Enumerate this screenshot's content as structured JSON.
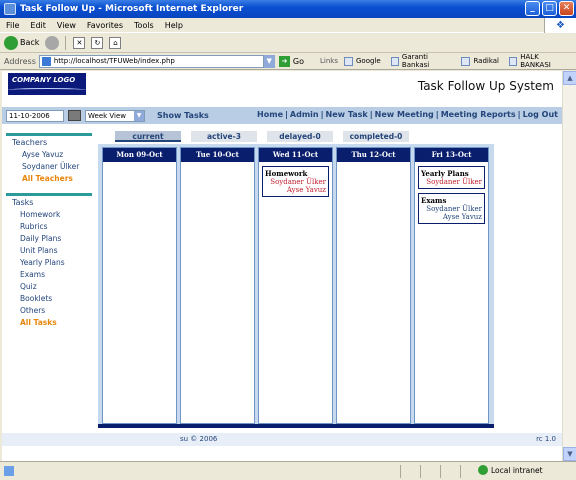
{
  "window": {
    "title": "Task Follow Up - Microsoft Internet Explorer",
    "controls": {
      "minimize": "_",
      "maximize": "□",
      "close": "✕"
    }
  },
  "menu": [
    "File",
    "Edit",
    "View",
    "Favorites",
    "Tools",
    "Help"
  ],
  "toolbar": {
    "back": "Back",
    "go": "Go"
  },
  "address": {
    "label": "Address",
    "url": "http://localhost/TFUWeb/index.php"
  },
  "links": {
    "title": "Links",
    "items": [
      "Google",
      "Garanti Bankasi",
      "Radikal",
      "HALK BANKASI"
    ]
  },
  "page": {
    "logo": "COMPANY LOGO",
    "system_title": "Task Follow Up System",
    "date_value": "11-10-2006",
    "view_value": "Week View",
    "show_tasks": "Show Tasks",
    "nav": [
      "Home",
      "Admin",
      "New Task",
      "New Meeting",
      "Meeting Reports",
      "Log Out"
    ],
    "nav_sep": "|",
    "sidebar": {
      "teachers_title": "Teachers",
      "teachers": [
        "Ayse Yavuz",
        "Soydaner Ülker"
      ],
      "all_teachers": "All Teachers",
      "tasks_title": "Tasks",
      "tasks": [
        "Homework",
        "Rubrics",
        "Daily Plans",
        "Unit Plans",
        "Yearly Plans",
        "Exams",
        "Quiz",
        "Booklets",
        "Others"
      ],
      "all_tasks": "All Tasks"
    },
    "tabs": [
      "current",
      "active-3",
      "delayed-0",
      "completed-0"
    ],
    "days": [
      {
        "label": "Mon 09-Oct",
        "cards": []
      },
      {
        "label": "Tue 10-Oct",
        "cards": []
      },
      {
        "label": "Wed 11-Oct",
        "cards": [
          {
            "title": "Homework",
            "names": [
              "Soydaner Ülker",
              "Ayse Yavuz"
            ]
          }
        ]
      },
      {
        "label": "Thu 12-Oct",
        "cards": []
      },
      {
        "label": "Fri 13-Oct",
        "cards": [
          {
            "title": "Yearly Plans",
            "names": [
              "Soydaner Ülker"
            ]
          },
          {
            "title": "Exams",
            "names": [
              "Soydaner Ülker",
              "Ayse Yavuz"
            ]
          }
        ]
      }
    ],
    "footer_copy": "su © 2006",
    "footer_version": "rc 1.0"
  },
  "status": {
    "zone": "Local intranet"
  },
  "colors": {
    "accent_dark": "#0a1e6e",
    "link": "#23457a",
    "highlight": "#e8860c",
    "name_red": "#c0202e"
  }
}
